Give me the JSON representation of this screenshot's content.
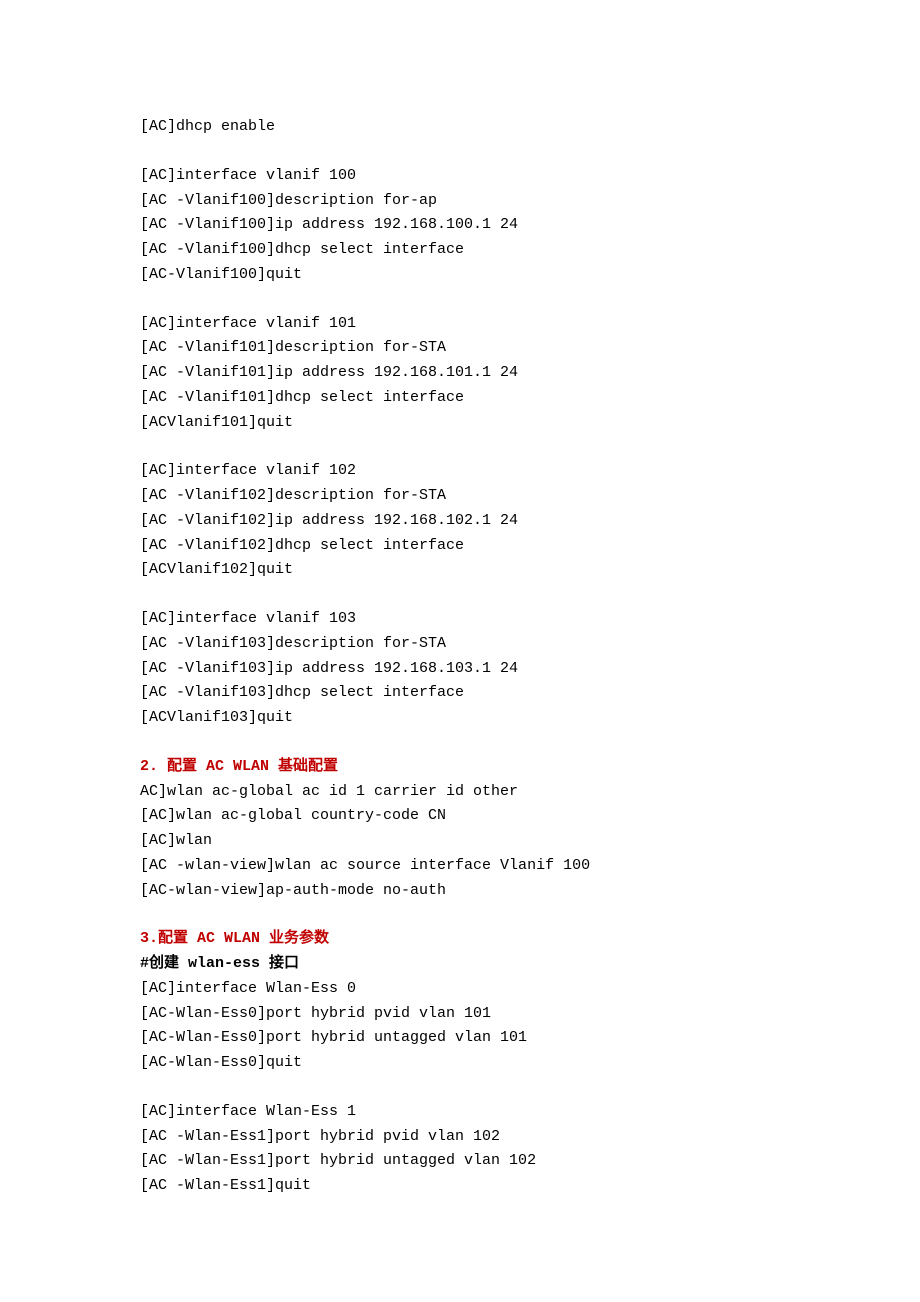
{
  "blocks": [
    {
      "lines": [
        "[AC]dhcp enable"
      ]
    },
    {
      "lines": [
        "[AC]interface vlanif 100",
        "[AC -Vlanif100]description for-ap",
        "[AC -Vlanif100]ip address 192.168.100.1 24",
        "[AC -Vlanif100]dhcp select interface",
        "[AC-Vlanif100]quit"
      ]
    },
    {
      "lines": [
        "[AC]interface vlanif 101",
        "[AC -Vlanif101]description for-STA",
        "[AC -Vlanif101]ip address 192.168.101.1 24",
        "[AC -Vlanif101]dhcp select interface",
        "[ACVlanif101]quit"
      ]
    },
    {
      "lines": [
        "[AC]interface vlanif 102",
        "[AC -Vlanif102]description for-STA",
        "[AC -Vlanif102]ip address 192.168.102.1 24",
        "[AC -Vlanif102]dhcp select interface",
        "[ACVlanif102]quit"
      ]
    },
    {
      "lines": [
        "[AC]interface vlanif 103",
        "[AC -Vlanif103]description for-STA",
        "[AC -Vlanif103]ip address 192.168.103.1 24",
        "[AC -Vlanif103]dhcp select interface",
        "[ACVlanif103]quit"
      ]
    }
  ],
  "section2": {
    "heading": "2. 配置 AC WLAN 基础配置",
    "lines": [
      "AC]wlan ac-global ac id 1 carrier id other",
      "[AC]wlan ac-global country-code CN",
      "[AC]wlan",
      "[AC -wlan-view]wlan ac source interface Vlanif 100",
      "[AC-wlan-view]ap-auth-mode no-auth"
    ]
  },
  "section3": {
    "heading": "3.配置 AC WLAN 业务参数",
    "subheading": "#创建 wlan-ess 接口",
    "block1": [
      "[AC]interface Wlan-Ess 0",
      "[AC-Wlan-Ess0]port hybrid pvid vlan 101",
      "[AC-Wlan-Ess0]port hybrid untagged vlan 101",
      "[AC-Wlan-Ess0]quit"
    ],
    "block2": [
      "[AC]interface Wlan-Ess 1",
      "[AC -Wlan-Ess1]port hybrid pvid vlan 102",
      "[AC -Wlan-Ess1]port hybrid untagged vlan 102",
      "[AC -Wlan-Ess1]quit"
    ]
  }
}
